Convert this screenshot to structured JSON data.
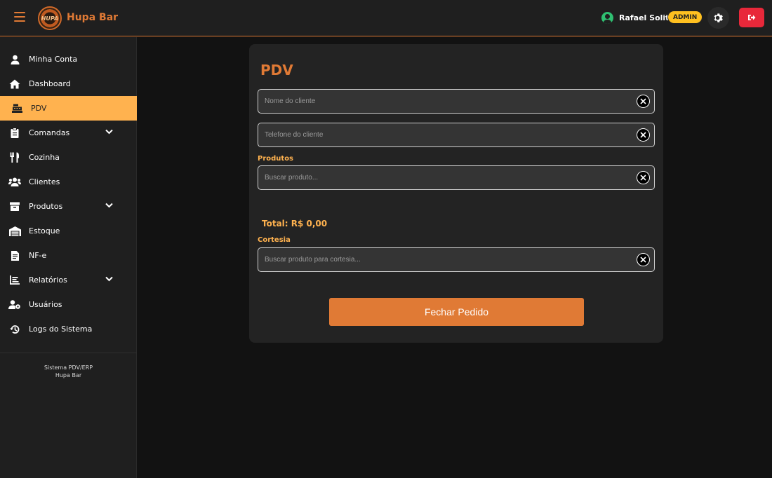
{
  "header": {
    "app_title": "Hupa Bar",
    "logo_text": "HUPA",
    "user_name": "Rafael Solito",
    "role_badge": "ADMIN"
  },
  "sidebar": {
    "items": [
      {
        "label": "Minha Conta",
        "icon": "user-icon"
      },
      {
        "label": "Dashboard",
        "icon": "home-icon"
      },
      {
        "label": "PDV",
        "icon": "cash-register-icon",
        "active": true
      },
      {
        "label": "Comandas",
        "icon": "clipboard-icon",
        "expandable": true
      },
      {
        "label": "Cozinha",
        "icon": "utensils-icon"
      },
      {
        "label": "Clientes",
        "icon": "users-icon"
      },
      {
        "label": "Produtos",
        "icon": "box-icon",
        "expandable": true
      },
      {
        "label": "Estoque",
        "icon": "warehouse-icon"
      },
      {
        "label": "NF-e",
        "icon": "invoice-icon"
      },
      {
        "label": "Relatórios",
        "icon": "chart-icon",
        "expandable": true
      },
      {
        "label": "Usuários",
        "icon": "user-cog-icon"
      },
      {
        "label": "Logs do Sistema",
        "icon": "history-icon"
      }
    ],
    "footer_line1": "Sistema PDV/ERP",
    "footer_line2": "Hupa Bar"
  },
  "pdv": {
    "title": "PDV",
    "client_name_placeholder": "Nome do cliente",
    "client_phone_placeholder": "Telefone do cliente",
    "products_label": "Produtos",
    "products_placeholder": "Buscar produto...",
    "total_label": "Total: R$ 0,00",
    "courtesy_label": "Cortesia",
    "courtesy_placeholder": "Buscar produto para cortesia...",
    "submit_label": "Fechar Pedido"
  },
  "colors": {
    "accent": "#e07a35",
    "active_nav": "#ffb24f",
    "badge": "#ffc020",
    "logout": "#e8283a",
    "online": "#2fbf71"
  }
}
